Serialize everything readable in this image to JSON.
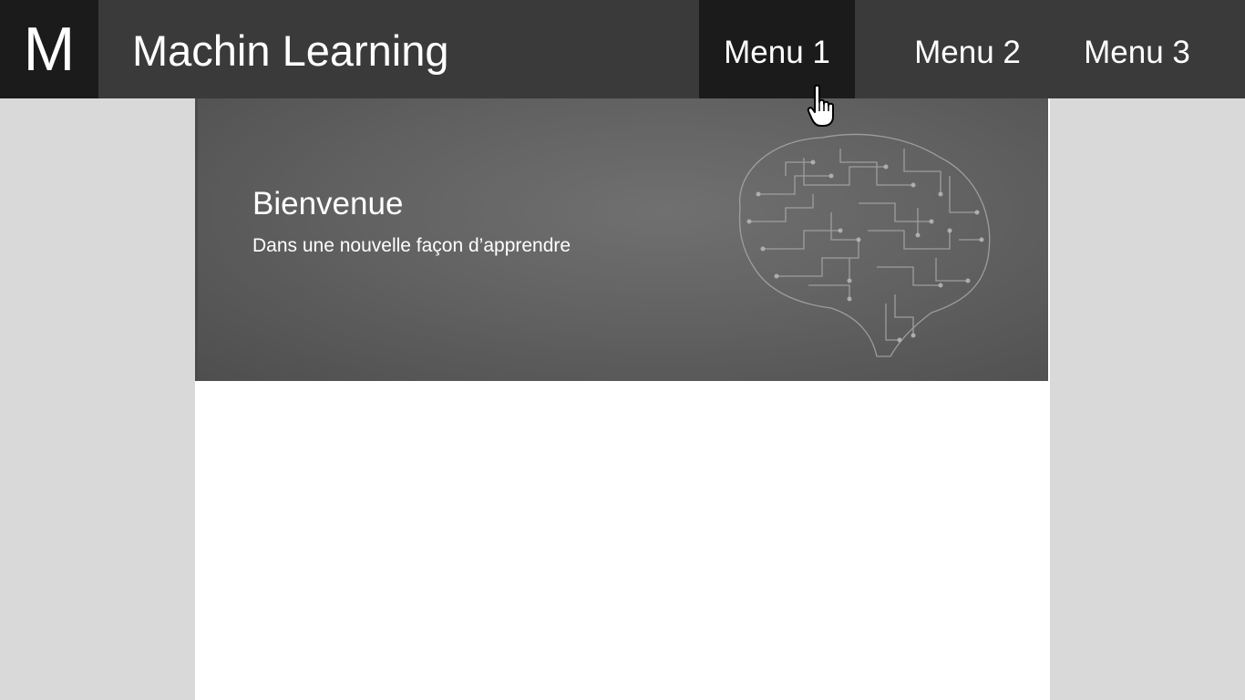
{
  "header": {
    "logo_letter": "M",
    "title": "Machin Learning",
    "menu": [
      {
        "label": "Menu 1",
        "active": true
      },
      {
        "label": "Menu 2",
        "active": false
      },
      {
        "label": "Menu 3",
        "active": false
      }
    ]
  },
  "hero": {
    "title": "Bienvenue",
    "subtitle": "Dans une nouvelle façon d’apprendre",
    "illustration": "circuit-brain"
  },
  "colors": {
    "topbar": "#3a3a3a",
    "active_menu": "#1b1b1b",
    "page_background": "#d9d9d9",
    "content_background": "#ffffff"
  }
}
